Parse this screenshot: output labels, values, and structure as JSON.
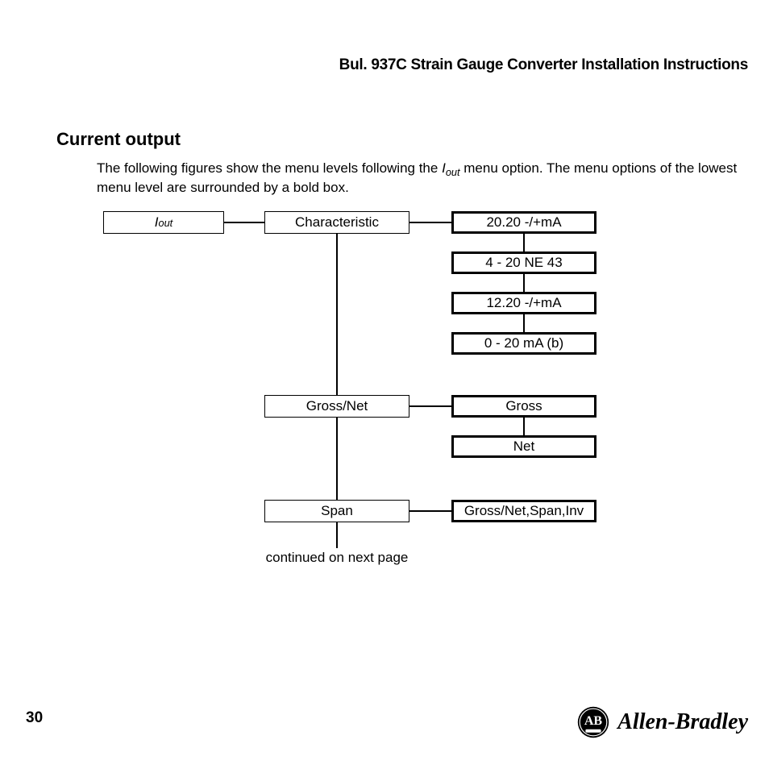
{
  "header": {
    "title": "Bul. 937C Strain Gauge Converter Installation Instructions"
  },
  "section": {
    "heading": "Current output",
    "body_prefix": "The following figures show the menu levels following the ",
    "body_var_base": "I",
    "body_var_sub": "out",
    "body_suffix": " menu option. The menu options of the lowest menu level are surrounded by a bold box."
  },
  "diagram": {
    "root_base": "I",
    "root_sub": "out",
    "level2": {
      "characteristic": "Characteristic",
      "gross_net": "Gross/Net",
      "span": "Span"
    },
    "level3": {
      "char_1": "20.20 -/+mA",
      "char_2": "4 - 20 NE 43",
      "char_3": "12.20 -/+mA",
      "char_4": "0 - 20 mA (b)",
      "gn_1": "Gross",
      "gn_2": "Net",
      "span_1": "Gross/Net,Span,Inv"
    },
    "continued": "continued on next page"
  },
  "footer": {
    "page": "30",
    "brand": "Allen-Bradley",
    "brand_icon_text": "AB"
  },
  "chart_data": {
    "type": "table",
    "title": "Iout menu tree",
    "tree": {
      "label": "I_out",
      "children": [
        {
          "label": "Characteristic",
          "bold": false,
          "children": [
            {
              "label": "20.20 -/+mA",
              "bold": true
            },
            {
              "label": "4 - 20 NE 43",
              "bold": true
            },
            {
              "label": "12.20 -/+mA",
              "bold": true
            },
            {
              "label": "0 - 20 mA (b)",
              "bold": true
            }
          ]
        },
        {
          "label": "Gross/Net",
          "bold": false,
          "children": [
            {
              "label": "Gross",
              "bold": true
            },
            {
              "label": "Net",
              "bold": true
            }
          ]
        },
        {
          "label": "Span",
          "bold": false,
          "children": [
            {
              "label": "Gross/Net,Span,Inv",
              "bold": true
            }
          ]
        }
      ],
      "note": "continued on next page"
    }
  }
}
